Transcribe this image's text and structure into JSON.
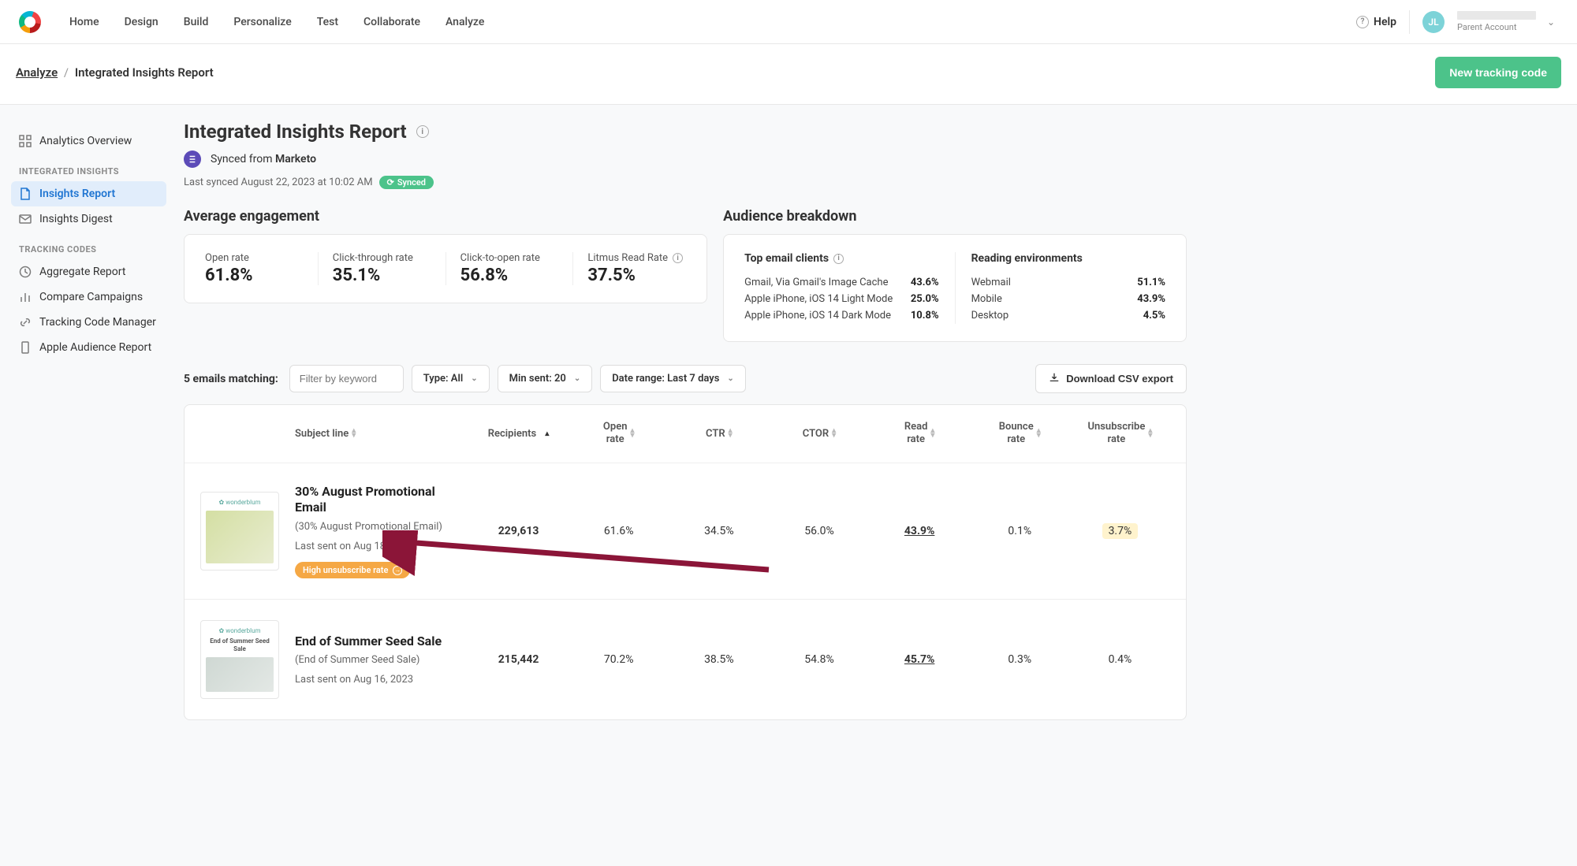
{
  "header": {
    "nav": [
      "Home",
      "Design",
      "Build",
      "Personalize",
      "Test",
      "Collaborate",
      "Analyze"
    ],
    "help_label": "Help",
    "avatar_initials": "JL",
    "account_label": "Parent Account"
  },
  "subheader": {
    "breadcrumb_root": "Analyze",
    "breadcrumb_current": "Integrated Insights Report",
    "new_tracking_btn": "New tracking code"
  },
  "sidebar": {
    "items_top": [
      {
        "label": "Analytics Overview"
      }
    ],
    "heading1": "INTEGRATED INSIGHTS",
    "items_mid": [
      {
        "label": "Insights Report",
        "active": true
      },
      {
        "label": "Insights Digest"
      }
    ],
    "heading2": "TRACKING CODES",
    "items_bottom": [
      {
        "label": "Aggregate Report"
      },
      {
        "label": "Compare Campaigns"
      },
      {
        "label": "Tracking Code Manager"
      },
      {
        "label": "Apple Audience Report"
      }
    ]
  },
  "page": {
    "title": "Integrated Insights Report",
    "synced_from_prefix": "Synced from ",
    "synced_from_source": "Marketo",
    "last_synced": "Last synced August 22, 2023 at 10:02 AM",
    "synced_badge": "Synced"
  },
  "engagement": {
    "heading": "Average engagement",
    "metrics": [
      {
        "label": "Open rate",
        "value": "61.8%"
      },
      {
        "label": "Click-through rate",
        "value": "35.1%"
      },
      {
        "label": "Click-to-open rate",
        "value": "56.8%"
      },
      {
        "label": "Litmus Read Rate",
        "value": "37.5%",
        "info": true
      }
    ]
  },
  "breakdown": {
    "heading": "Audience breakdown",
    "clients_heading": "Top email clients",
    "clients": [
      {
        "name": "Gmail, Via Gmail's Image Cache",
        "value": "43.6%"
      },
      {
        "name": "Apple iPhone, iOS 14 Light Mode",
        "value": "25.0%"
      },
      {
        "name": "Apple iPhone, iOS 14 Dark Mode",
        "value": "10.8%"
      }
    ],
    "env_heading": "Reading environments",
    "envs": [
      {
        "name": "Webmail",
        "value": "51.1%"
      },
      {
        "name": "Mobile",
        "value": "43.9%"
      },
      {
        "name": "Desktop",
        "value": "4.5%"
      }
    ]
  },
  "filters": {
    "count_label": "5 emails matching:",
    "filter_placeholder": "Filter by keyword",
    "type_label": "Type: All",
    "min_sent_label": "Min sent: 20",
    "date_range_label": "Date range: Last 7 days",
    "download_label": "Download CSV export"
  },
  "table": {
    "columns": {
      "subject": "Subject line",
      "recipients": "Recipients",
      "open_rate_1": "Open",
      "open_rate_2": "rate",
      "ctr": "CTR",
      "ctor": "CTOR",
      "read_rate_1": "Read",
      "read_rate_2": "rate",
      "bounce_rate_1": "Bounce",
      "bounce_rate_2": "rate",
      "unsub_rate_1": "Unsubscribe",
      "unsub_rate_2": "rate"
    },
    "rows": [
      {
        "title": "30% August Promotional Email",
        "subtitle": "(30% August Promotional Email)",
        "sent": "Last sent on Aug 18, 2023",
        "warning": "High unsubscribe rate",
        "recipients": "229,613",
        "open_rate": "61.6%",
        "ctr": "34.5%",
        "ctor": "56.0%",
        "read_rate": "43.9%",
        "bounce_rate": "0.1%",
        "unsub_rate": "3.7%",
        "unsub_highlight": true,
        "thumb_brand": "wonderblum"
      },
      {
        "title": "End of Summer Seed Sale",
        "subtitle": "(End of Summer Seed Sale)",
        "sent": "Last sent on Aug 16, 2023",
        "recipients": "215,442",
        "open_rate": "70.2%",
        "ctr": "38.5%",
        "ctor": "54.8%",
        "read_rate": "45.7%",
        "bounce_rate": "0.3%",
        "unsub_rate": "0.4%",
        "thumb_brand": "wonderblum",
        "thumb_title": "End of Summer Seed Sale"
      }
    ]
  }
}
